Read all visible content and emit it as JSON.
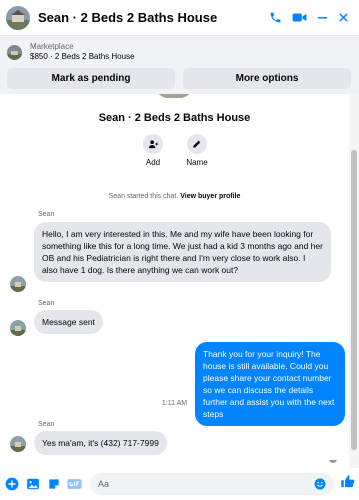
{
  "header": {
    "title": "Sean · 2 Beds 2 Baths House"
  },
  "marketplace": {
    "label": "Marketplace",
    "item": "$850 · 2 Beds 2 Baths House",
    "pending_button": "Mark as pending",
    "options_button": "More options"
  },
  "chat": {
    "title": "Sean · 2 Beds 2 Baths House",
    "actions": {
      "add": "Add",
      "name": "Name"
    },
    "system": {
      "prefix": "Sean started this chat.",
      "link": "View buyer profile"
    },
    "messages": [
      {
        "sender": "Sean",
        "text": "Hello, I am very interested in this. Me and my wife have been looking for something like this for a long time. We just had a kid 3 months ago and her OB and his Pediatrician is right there and I'm very close to work also. I also have 1 dog. Is there anything we can work out?"
      },
      {
        "sender": "Sean",
        "text": "Message sent"
      },
      {
        "sender": "",
        "text": "Thank you for your inquiry! The house is still available. Could you please share your contact number so we can discuss the details further and assist you with the next steps"
      },
      {
        "timestamp": "1:11 AM"
      },
      {
        "sender": "Sean",
        "text": "Yes ma'am, it's (432) 717-7999"
      }
    ]
  },
  "composer": {
    "placeholder": "Aa"
  },
  "colors": {
    "accent": "#0084ff",
    "incoming_bubble": "#e4e6eb",
    "panel_bg": "#f0f2f5"
  }
}
